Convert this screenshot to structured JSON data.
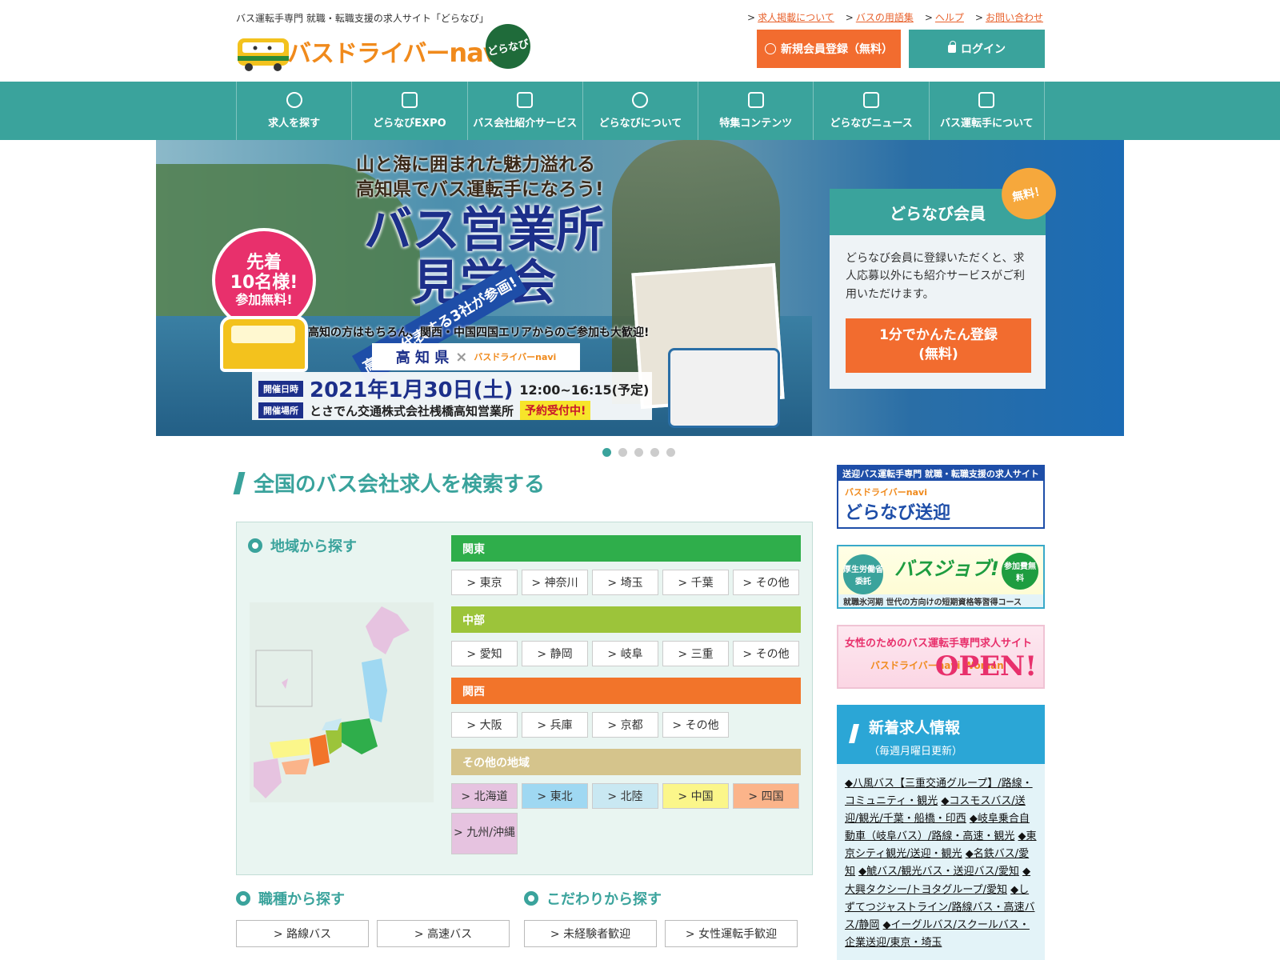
{
  "header": {
    "tagline": "バス運転手専門 就職・転職支援の求人サイト「どらなび」",
    "logo_text": "バスドライバー",
    "logo_navi": "navi",
    "logo_badge": "どらなび",
    "links": [
      "求人掲載について",
      "バスの用語集",
      "ヘルプ",
      "お問い合わせ"
    ],
    "register_label": "新規会員登録（無料）",
    "login_label": "ログイン"
  },
  "nav": {
    "items": [
      "求人を探す",
      "どらなびEXPO",
      "バス会社紹介サービス",
      "どらなびについて",
      "特集コンテンツ",
      "どらなびニュース",
      "バス運転手について"
    ]
  },
  "hero": {
    "ribbon": "高知を代表する3社が参画!",
    "badge": [
      "先着",
      "10名様!",
      "参加無料!"
    ],
    "copy_line1": "山と海に囲まれた魅力溢れる",
    "copy_line2": "高知県でバス運転手になろう!",
    "title_line1": "バス営業所",
    "title_line2": "見学会",
    "sub": "高知の方はもちろん、関西・中国四国エリアからのご参加も大歓迎!",
    "pref": "高 知 県",
    "pref_x": "×",
    "pref_brand": "バスドライバーnavi",
    "date_tag": "開催日時",
    "date": "2021年1月30日(土)",
    "time": "12:00~16:15(予定)",
    "place_tag": "開催場所",
    "place": "とさでん交通株式会社桟橋高知営業所",
    "reserve": "予約受付中!"
  },
  "member": {
    "bubble": "無料！",
    "title": "どらなび会員",
    "text": "どらなび会員に登録いただくと、求人応募以外にも紹介サービスがご利用いただけます。",
    "btn_line1": "1分でかんたん登録",
    "btn_line2": "(無料)"
  },
  "search": {
    "title": "全国のバス会社求人を検索する",
    "area_title": "地域から探す",
    "regions": [
      {
        "name": "関東",
        "color": "#2fae4b",
        "items": [
          "> 東京",
          "> 神奈川",
          "> 埼玉",
          "> 千葉",
          "> その他"
        ]
      },
      {
        "name": "中部",
        "color": "#9cc43a",
        "items": [
          "> 愛知",
          "> 静岡",
          "> 岐阜",
          "> 三重",
          "> その他"
        ]
      },
      {
        "name": "関西",
        "color": "#f2742a",
        "items": [
          "> 大阪",
          "> 兵庫",
          "> 京都",
          "> その他"
        ]
      },
      {
        "name": "その他の地域",
        "color": "#d5c48c",
        "items": [
          "> 北海道",
          "> 東北",
          "> 北陸",
          "> 中国",
          "> 四国",
          "> 九州/沖縄"
        ]
      }
    ],
    "other_colors": [
      "#e6c3e0",
      "#9fd8f2",
      "#c9e8f2",
      "#fbf68a",
      "#fbb48a",
      "#e6c3e0"
    ],
    "job_title": "職種から探す",
    "job_items": [
      "> 路線バス",
      "> 高速バス"
    ],
    "pref_title": "こだわりから探す",
    "pref_items": [
      "> 未経験者歓迎",
      "> 女性運転手歓迎"
    ]
  },
  "sidebar": {
    "banner1_strip": "送迎バス運転手専門 就職・転職支援の求人サイト",
    "banner1_brand": "バスドライバーnavi",
    "banner1_big": "どらなび送迎",
    "banner2_left": "厚生労働省委託",
    "banner2_big": "バスジョブ!",
    "banner2_right": "参加費無料",
    "banner2_foot": "就職氷河期 世代の方向けの短期資格等習得コース",
    "banner3_top": "女性のためのバス運転手専門求人サイト",
    "banner3_brand": "バスドライバーnavi Woman",
    "banner3_open": "OPEN!",
    "news_title": "新着求人情報",
    "news_sub": "（毎週月曜日更新）",
    "news_items": [
      "◆八風バス【三重交通グループ】/路線・コミュニティ・観光",
      "◆コスモスバス/送迎/観光/千葉・船橋・印西",
      "◆岐阜乗合自動車（岐阜バス）/路線・高速・観光",
      "◆東京シティ観光/送迎・観光",
      "◆名鉄バス/愛知",
      "◆鯱バス/観光バス・送迎バス/愛知",
      "◆大興タクシー/トヨタグループ/愛知",
      "◆しずてつジャストライン/路線バス・高速バス/静岡",
      "◆イーグルバス/スクールバス・企業送迎/東京・埼玉"
    ]
  }
}
